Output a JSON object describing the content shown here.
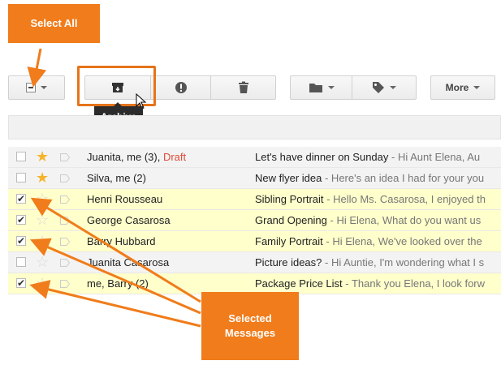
{
  "callouts": {
    "select_all": "Select All",
    "selected_line1": "Selected",
    "selected_line2": "Messages"
  },
  "toolbar": {
    "archive_tooltip": "Archive",
    "more_label": "More"
  },
  "messages": [
    {
      "sender": "Juanita, me (3)",
      "draft": "Draft",
      "subject": "Let's have dinner on Sunday",
      "snippet": " - Hi Aunt Elena, Au",
      "starred": true,
      "checked": false,
      "state": "read"
    },
    {
      "sender": "Silva, me (2)",
      "draft": "",
      "subject": "New flyer idea",
      "snippet": " - Here's an idea I had for your you",
      "starred": true,
      "checked": false,
      "state": "read"
    },
    {
      "sender": "Henri Rousseau",
      "draft": "",
      "subject": "Sibling Portrait",
      "snippet": " - Hello Ms. Casarosa, I enjoyed th",
      "starred": false,
      "checked": true,
      "state": "selected"
    },
    {
      "sender": "George Casarosa",
      "draft": "",
      "subject": "Grand Opening",
      "snippet": " - Hi Elena, What do you want us",
      "starred": false,
      "checked": true,
      "state": "selected"
    },
    {
      "sender": "Barry Hubbard",
      "draft": "",
      "subject": "Family Portrait",
      "snippet": " - Hi Elena, We've looked over the",
      "starred": false,
      "checked": true,
      "state": "selected"
    },
    {
      "sender": "Juanita Casarosa",
      "draft": "",
      "subject": "Picture ideas?",
      "snippet": " - Hi Auntie, I'm wondering what I s",
      "starred": false,
      "checked": false,
      "state": "read"
    },
    {
      "sender": "me, Barry (2)",
      "draft": "",
      "subject": "Package Price List",
      "snippet": " - Thank you Elena, I look forw",
      "starred": false,
      "checked": true,
      "state": "selected"
    }
  ],
  "colors": {
    "callout_orange": "#f07c1b",
    "selected_row": "#ffffcc",
    "star_on": "#f6b42b",
    "draft_red": "#dd4b39"
  }
}
